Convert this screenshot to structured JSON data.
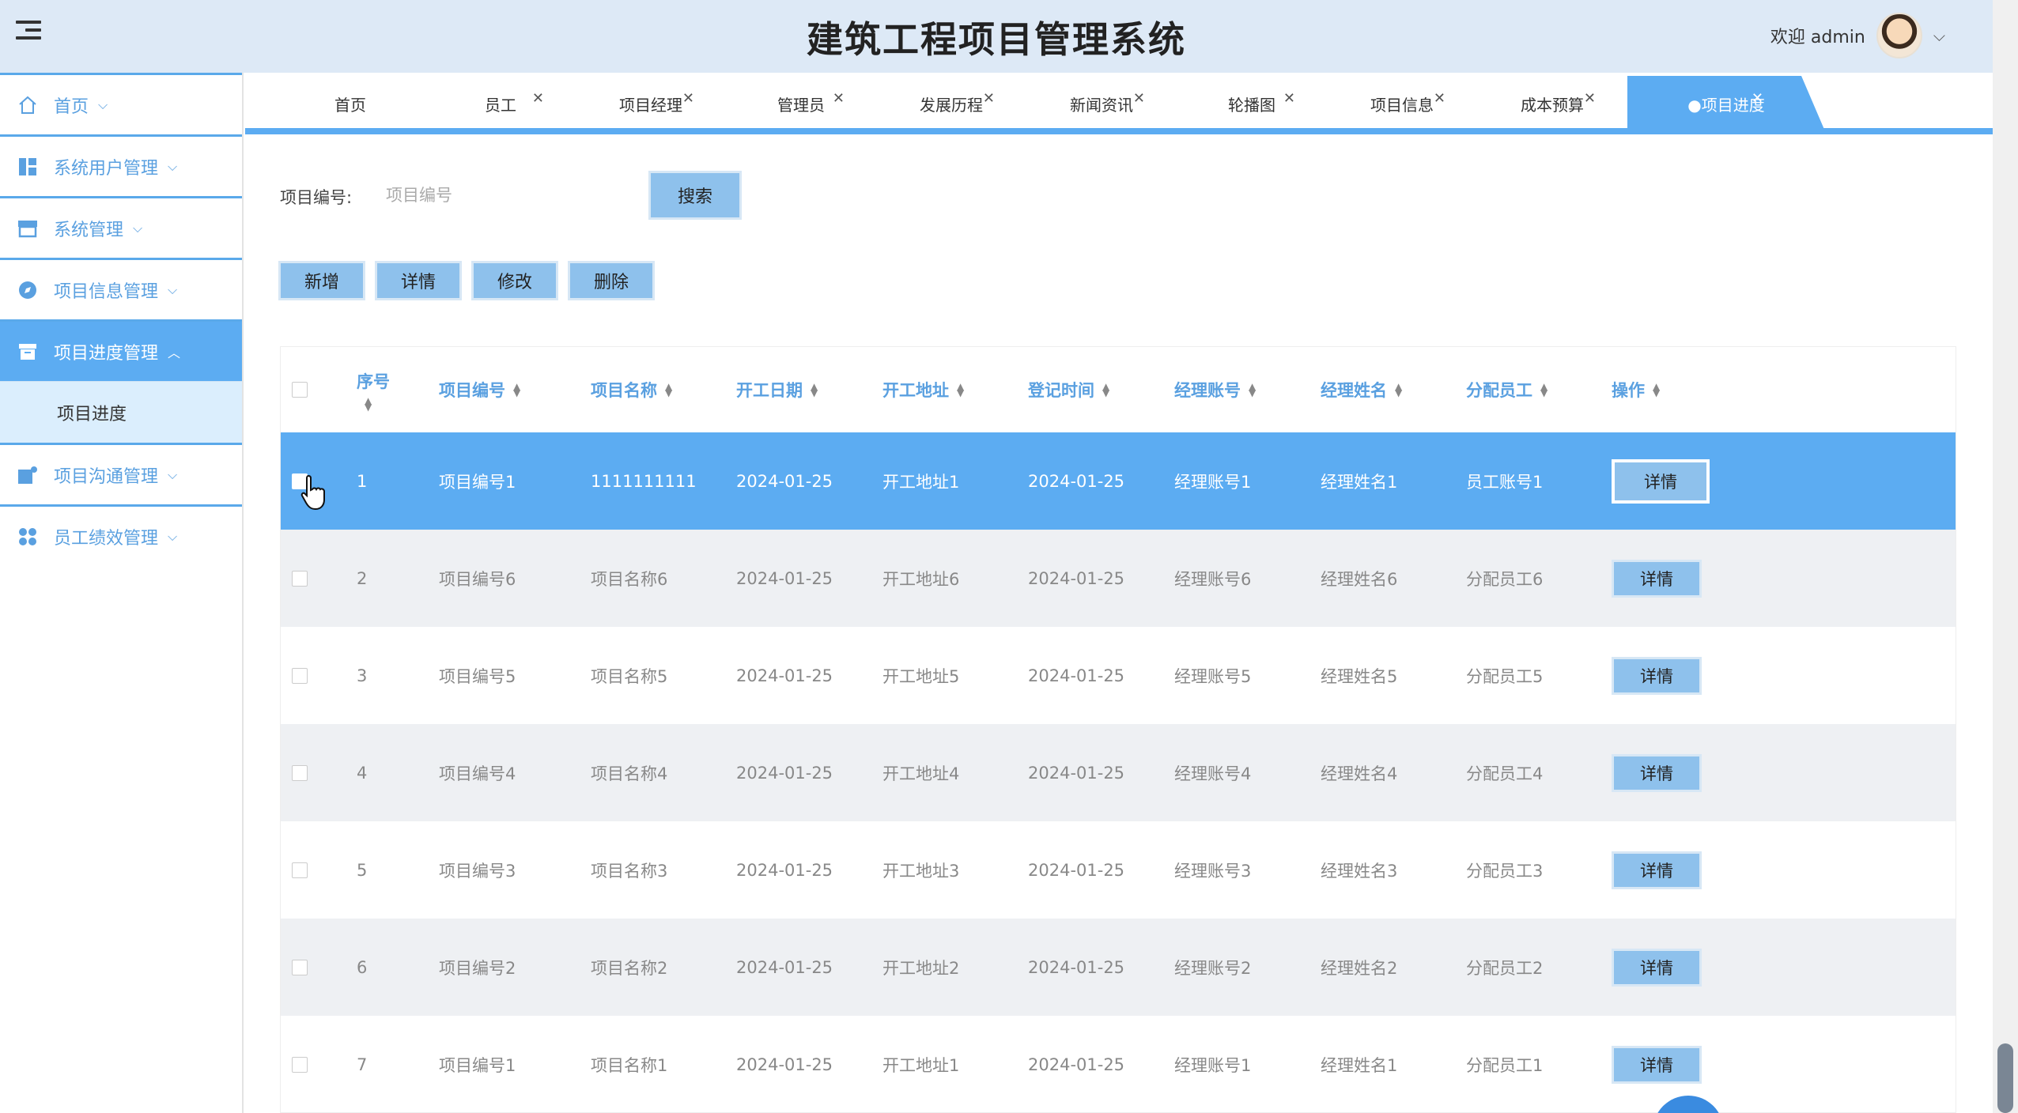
{
  "header": {
    "title": "建筑工程项目管理系统",
    "welcome": "欢迎 admin"
  },
  "sidebar": {
    "items": [
      {
        "label": "首页",
        "icon": "home-icon",
        "expanded": false
      },
      {
        "label": "系统用户管理",
        "icon": "dashboard-icon",
        "expanded": false
      },
      {
        "label": "系统管理",
        "icon": "store-icon",
        "expanded": false
      },
      {
        "label": "项目信息管理",
        "icon": "compass-icon",
        "expanded": false
      },
      {
        "label": "项目进度管理",
        "icon": "archive-icon",
        "expanded": true
      },
      {
        "label": "项目沟通管理",
        "icon": "chat-icon",
        "expanded": false
      },
      {
        "label": "员工绩效管理",
        "icon": "grid-icon",
        "expanded": false
      }
    ],
    "submenu": {
      "label": "项目进度"
    }
  },
  "tabs": [
    {
      "label": "首页",
      "closable": false
    },
    {
      "label": "员工",
      "closable": true
    },
    {
      "label": "项目经理",
      "closable": true
    },
    {
      "label": "管理员",
      "closable": true
    },
    {
      "label": "发展历程",
      "closable": true
    },
    {
      "label": "新闻资讯",
      "closable": true
    },
    {
      "label": "轮播图",
      "closable": true
    },
    {
      "label": "项目信息",
      "closable": true
    },
    {
      "label": "成本预算",
      "closable": true
    },
    {
      "label": "●项目进度",
      "closable": true,
      "active": true
    }
  ],
  "search": {
    "label": "项目编号:",
    "placeholder": "项目编号",
    "button": "搜索"
  },
  "actions": {
    "add": "新增",
    "detail": "详情",
    "edit": "修改",
    "delete": "删除"
  },
  "table": {
    "headers": {
      "seq": "序号",
      "project_no": "项目编号",
      "project_name": "项目名称",
      "start_date": "开工日期",
      "address": "开工地址",
      "register_time": "登记时间",
      "manager_account": "经理账号",
      "manager_name": "经理姓名",
      "employee": "分配员工",
      "operation": "操作"
    },
    "detail_button": "详情",
    "rows": [
      {
        "seq": "1",
        "project_no": "项目编号1",
        "project_name": "1111111111",
        "start_date": "2024-01-25",
        "address": "开工地址1",
        "register_time": "2024-01-25",
        "manager_account": "经理账号1",
        "manager_name": "经理姓名1",
        "employee": "员工账号1",
        "selected": true
      },
      {
        "seq": "2",
        "project_no": "项目编号6",
        "project_name": "项目名称6",
        "start_date": "2024-01-25",
        "address": "开工地址6",
        "register_time": "2024-01-25",
        "manager_account": "经理账号6",
        "manager_name": "经理姓名6",
        "employee": "分配员工6"
      },
      {
        "seq": "3",
        "project_no": "项目编号5",
        "project_name": "项目名称5",
        "start_date": "2024-01-25",
        "address": "开工地址5",
        "register_time": "2024-01-25",
        "manager_account": "经理账号5",
        "manager_name": "经理姓名5",
        "employee": "分配员工5"
      },
      {
        "seq": "4",
        "project_no": "项目编号4",
        "project_name": "项目名称4",
        "start_date": "2024-01-25",
        "address": "开工地址4",
        "register_time": "2024-01-25",
        "manager_account": "经理账号4",
        "manager_name": "经理姓名4",
        "employee": "分配员工4"
      },
      {
        "seq": "5",
        "project_no": "项目编号3",
        "project_name": "项目名称3",
        "start_date": "2024-01-25",
        "address": "开工地址3",
        "register_time": "2024-01-25",
        "manager_account": "经理账号3",
        "manager_name": "经理姓名3",
        "employee": "分配员工3"
      },
      {
        "seq": "6",
        "project_no": "项目编号2",
        "project_name": "项目名称2",
        "start_date": "2024-01-25",
        "address": "开工地址2",
        "register_time": "2024-01-25",
        "manager_account": "经理账号2",
        "manager_name": "经理姓名2",
        "employee": "分配员工2"
      },
      {
        "seq": "7",
        "project_no": "项目编号1",
        "project_name": "项目名称1",
        "start_date": "2024-01-25",
        "address": "开工地址1",
        "register_time": "2024-01-25",
        "manager_account": "经理账号1",
        "manager_name": "经理姓名1",
        "employee": "分配员工1"
      }
    ]
  },
  "colors": {
    "accent": "#5cacf2",
    "header_bg": "#dde9f6",
    "button_bg": "#8ec1ec",
    "link_text": "#5aa0e0"
  }
}
